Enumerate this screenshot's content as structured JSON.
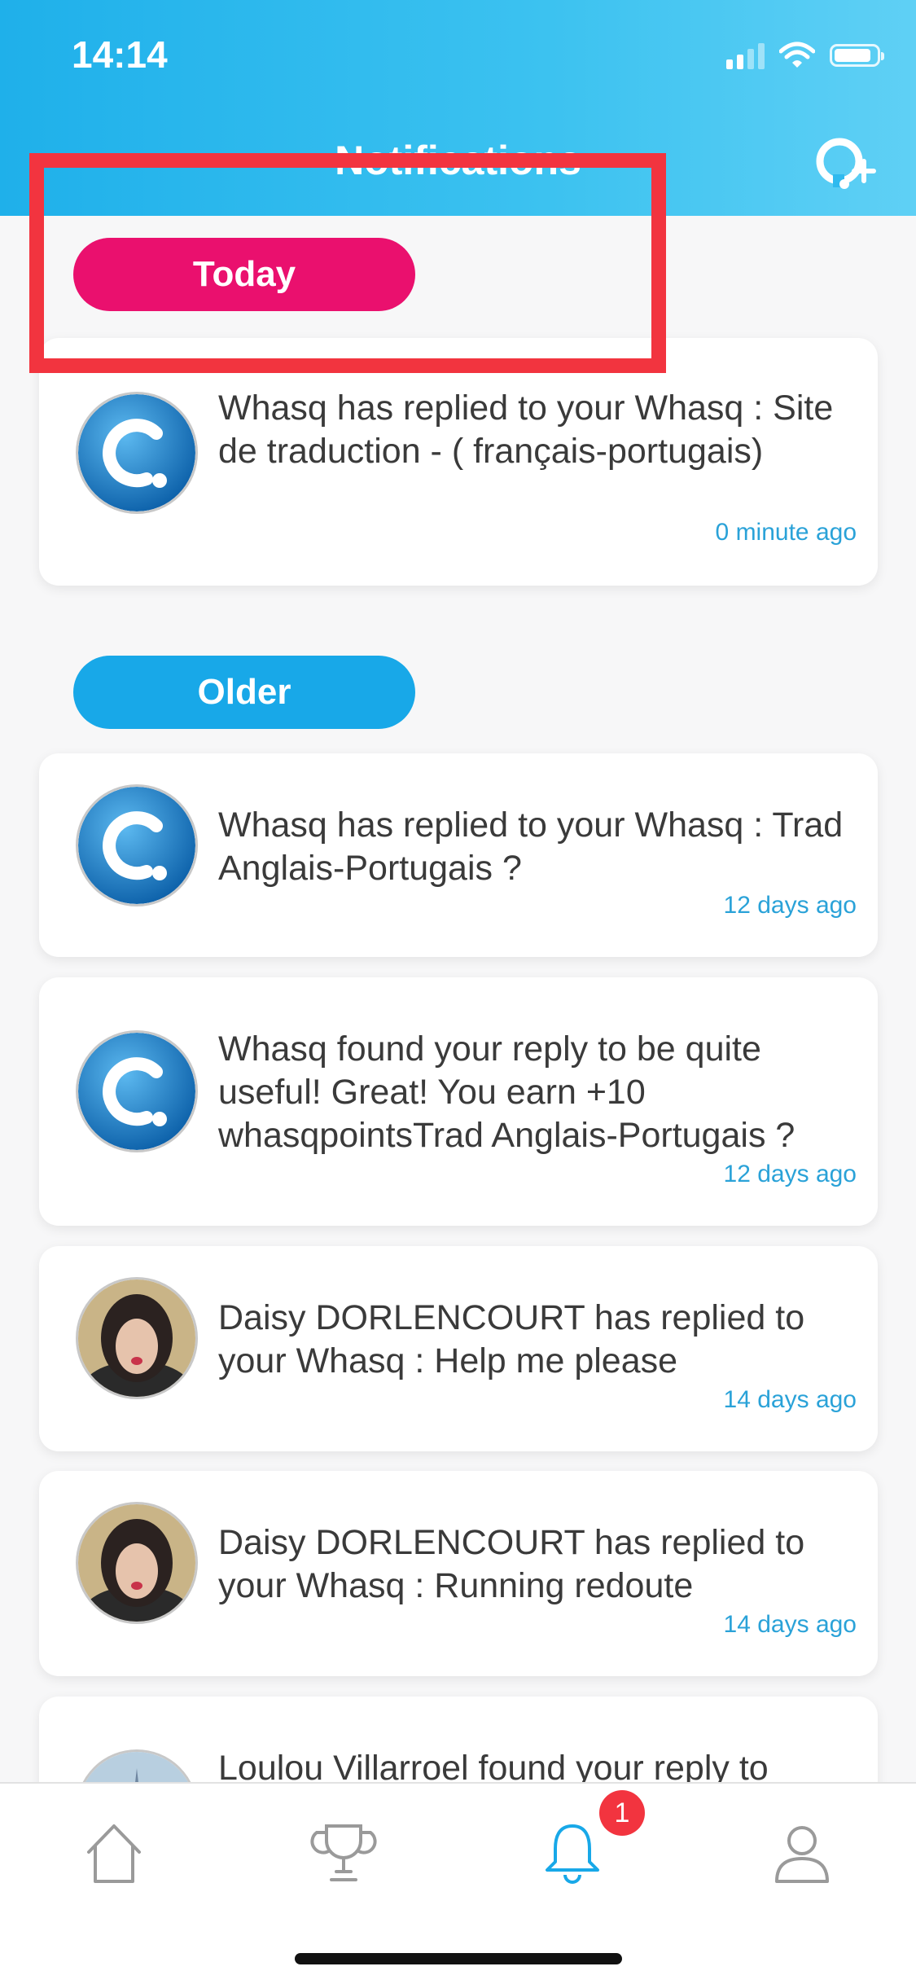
{
  "status_bar": {
    "time": "14:14"
  },
  "header": {
    "title": "Notifications",
    "new_question_icon": "question-plus-icon",
    "background": "#2bb8ee"
  },
  "sections": {
    "today_label": "Today",
    "older_label": "Older"
  },
  "notifications": [
    {
      "avatar": "whasq-logo",
      "message": "Whasq  has replied to your Whasq : Site de traduction  - ( français-portugais)",
      "time": "0 minute ago"
    },
    {
      "avatar": "whasq-logo",
      "message": "Whasq  has replied to your Whasq : Trad Anglais-Portugais ?",
      "time": "12 days ago"
    },
    {
      "avatar": "whasq-logo",
      "message": "Whasq  found your reply to be quite useful! Great! You earn +10 whasqpointsTrad Anglais-Portugais ?",
      "time": "12 days ago"
    },
    {
      "avatar": "user-photo",
      "message": "Daisy DORLENCOURT  has replied to your Whasq : Help me please",
      "time": "14 days ago"
    },
    {
      "avatar": "user-photo",
      "message": "Daisy DORLENCOURT  has replied to your Whasq : Running redoute",
      "time": "14 days ago"
    },
    {
      "avatar": "user-photo-eiffel",
      "message": "Loulou Villarroel  found your reply to",
      "time": ""
    }
  ],
  "tab_bar": {
    "tabs": [
      "home-icon",
      "trophy-icon",
      "bell-icon",
      "profile-icon"
    ],
    "active": "bell-icon",
    "notification_badge": "1"
  },
  "colors": {
    "today_pill": "#ea106e",
    "older_pill": "#18a8e8",
    "highlight_box": "#f2343f",
    "timestamp": "#2aa2d8",
    "active_tab": "#18a8e8"
  }
}
